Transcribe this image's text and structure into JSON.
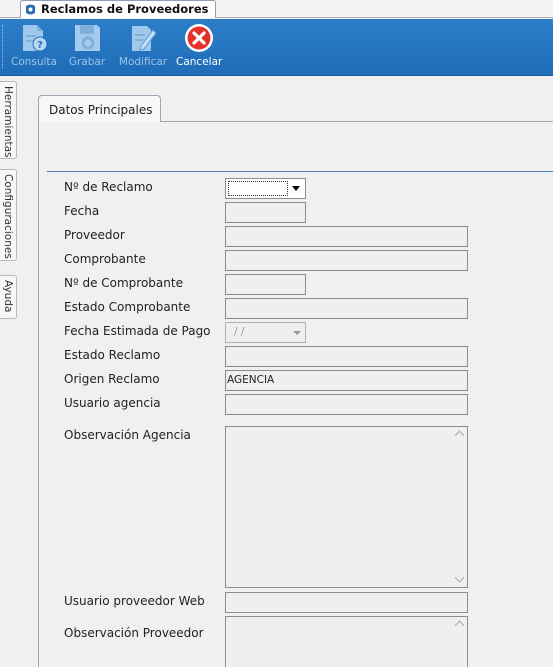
{
  "window": {
    "tab_title": "Reclamos de Proveedores"
  },
  "toolbar": {
    "consulta": "Consulta",
    "grabar": "Grabar",
    "modificar": "Modificar",
    "cancelar": "Cancelar"
  },
  "side_tabs": [
    "Herramientas",
    "Configuraciones",
    "Ayuda"
  ],
  "page_tab": "Datos Principales",
  "form": {
    "nro_reclamo_label": "Nº de Reclamo",
    "fecha_label": "Fecha",
    "proveedor_label": "Proveedor",
    "comprobante_label": "Comprobante",
    "nro_comprobante_label": "Nº de Comprobante",
    "estado_comprobante_label": "Estado Comprobante",
    "fecha_estimada_label": "Fecha Estimada de Pago",
    "fecha_estimada_value": "/  /",
    "estado_reclamo_label": "Estado Reclamo",
    "origen_reclamo_label": "Origen Reclamo",
    "origen_reclamo_value": "AGENCIA",
    "usuario_agencia_label": "Usuario agencia",
    "obs_agencia_label": "Observación Agencia",
    "usuario_proveedor_web_label": "Usuario proveedor Web",
    "obs_proveedor_label": "Observación Proveedor"
  }
}
